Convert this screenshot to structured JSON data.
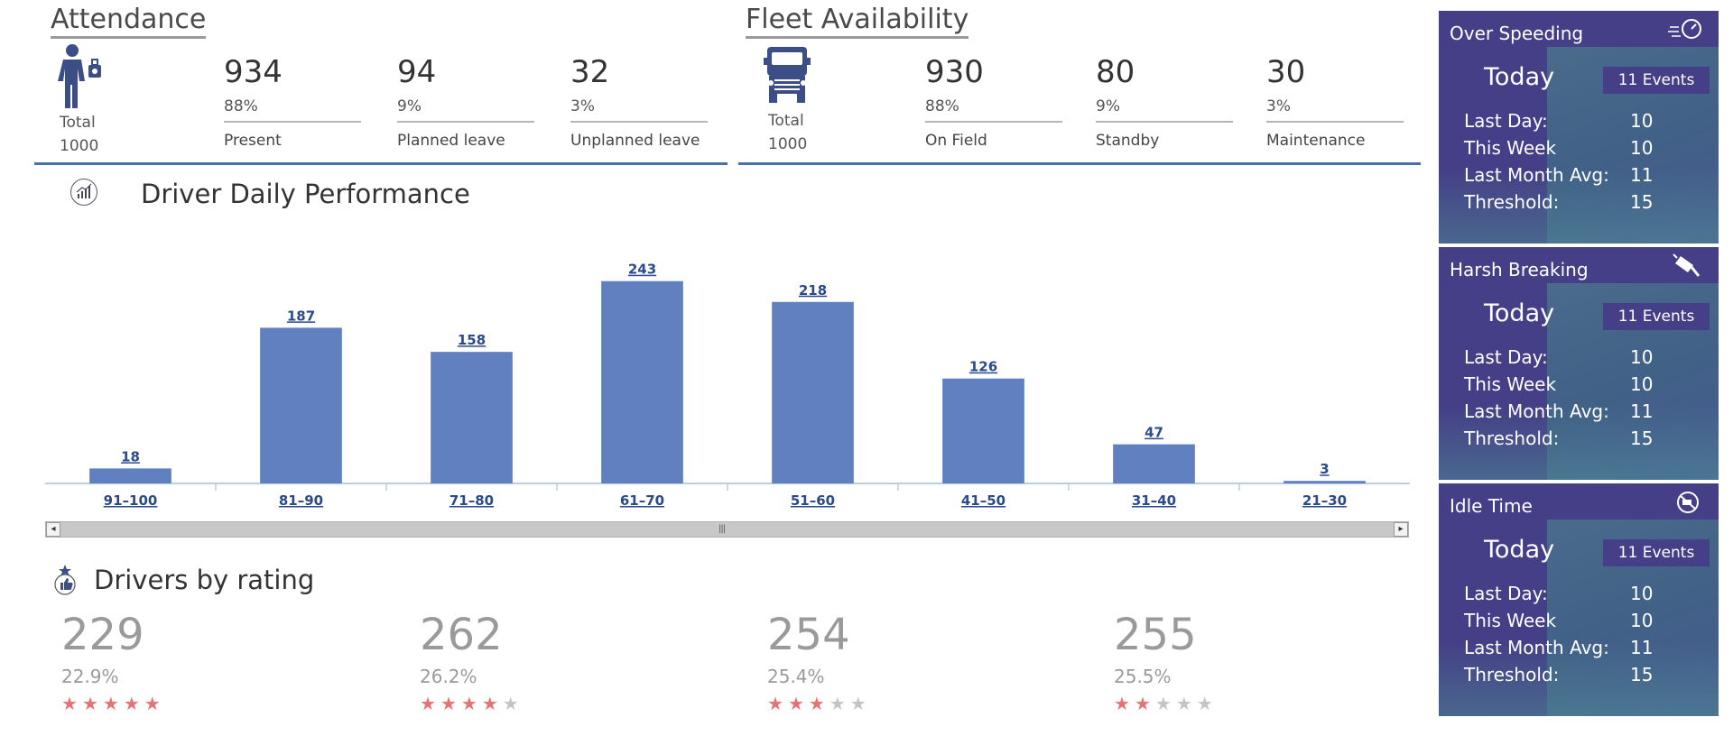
{
  "attendance": {
    "title": "Attendance",
    "total_label": "Total",
    "total_value": "1000",
    "kpis": [
      {
        "value": "934",
        "percent": "88%",
        "label": "Present"
      },
      {
        "value": "94",
        "percent": "9%",
        "label": "Planned leave"
      },
      {
        "value": "32",
        "percent": "3%",
        "label": "Unplanned leave"
      }
    ]
  },
  "fleet": {
    "title": "Fleet Availability",
    "total_label": "Total",
    "total_value": "1000",
    "kpis": [
      {
        "value": "930",
        "percent": "88%",
        "label": "On Field"
      },
      {
        "value": "80",
        "percent": "9%",
        "label": "Standby"
      },
      {
        "value": "30",
        "percent": "3%",
        "label": "Maintenance"
      }
    ]
  },
  "performance": {
    "title": "Driver Daily Performance"
  },
  "chart_data": {
    "type": "bar",
    "categories": [
      "91–100",
      "81–90",
      "71–80",
      "61–70",
      "51–60",
      "41–50",
      "31–40",
      "21–30"
    ],
    "values": [
      18,
      187,
      158,
      243,
      218,
      126,
      47,
      3
    ],
    "ylim": [
      0,
      260
    ],
    "grid": false,
    "bar_color": "#6080c0"
  },
  "ratings": {
    "title": "Drivers by rating",
    "items": [
      {
        "value": "229",
        "percent": "22.9%",
        "stars": 5
      },
      {
        "value": "262",
        "percent": "26.2%",
        "stars": 4
      },
      {
        "value": "254",
        "percent": "25.4%",
        "stars": 3
      },
      {
        "value": "255",
        "percent": "25.5%",
        "stars": 2
      }
    ]
  },
  "events": [
    {
      "title": "Over Speeding",
      "icon": "speedometer-icon",
      "today": "Today",
      "events": "11  Events",
      "rows": [
        {
          "label": "Last Day:",
          "value": "10"
        },
        {
          "label": "This Week",
          "value": "10"
        },
        {
          "label": "Last Month Avg:",
          "value": "11"
        },
        {
          "label": "Threshold:",
          "value": "15"
        }
      ]
    },
    {
      "title": "Harsh Breaking",
      "icon": "brake-pedal-icon",
      "today": "Today",
      "events": "11  Events",
      "rows": [
        {
          "label": "Last Day:",
          "value": "10"
        },
        {
          "label": "This Week",
          "value": "10"
        },
        {
          "label": "Last Month Avg:",
          "value": "11"
        },
        {
          "label": "Threshold:",
          "value": "15"
        }
      ]
    },
    {
      "title": "Idle Time",
      "icon": "idle-time-icon",
      "today": "Today",
      "events": "11  Events",
      "rows": [
        {
          "label": "Last Day:",
          "value": "10"
        },
        {
          "label": "This Week",
          "value": "10"
        },
        {
          "label": "Last Month Avg:",
          "value": "11"
        },
        {
          "label": "Threshold:",
          "value": "15"
        }
      ]
    }
  ],
  "colors": {
    "accent": "#4a6ea8",
    "card_bg": "#443f87",
    "bar": "#6080c0",
    "star_on": "#e57373",
    "star_off": "#c4c4c4"
  }
}
